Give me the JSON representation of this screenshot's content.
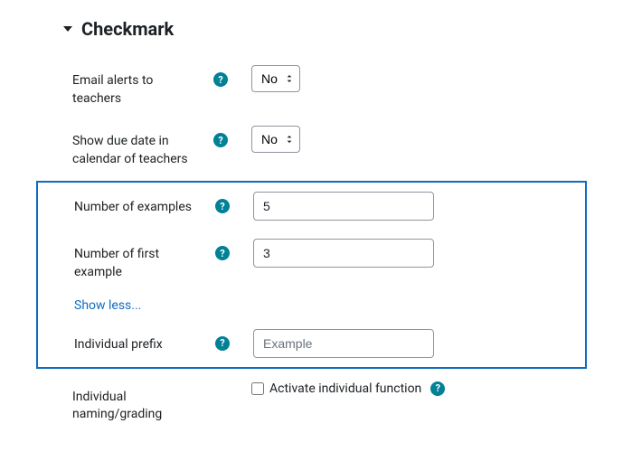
{
  "section": {
    "title": "Checkmark"
  },
  "fields": {
    "email_alerts": {
      "label": "Email alerts to teachers",
      "value": "No"
    },
    "due_date_calendar": {
      "label": "Show due date in calendar of teachers",
      "value": "No"
    },
    "num_examples": {
      "label": "Number of examples",
      "value": "5"
    },
    "num_first_example": {
      "label": "Number of first example",
      "value": "3"
    },
    "individual_prefix": {
      "label": "Individual prefix",
      "placeholder": "Example"
    },
    "individual_naming": {
      "label": "Individual naming/grading",
      "checkbox_label": "Activate individual function"
    }
  },
  "links": {
    "show_less": "Show less..."
  },
  "help_glyph": "?"
}
